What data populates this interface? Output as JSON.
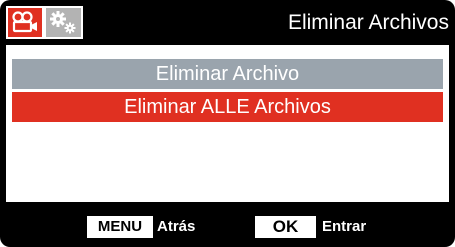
{
  "header": {
    "title": "Eliminar Archivos",
    "tabs": [
      {
        "icon": "video-camera-icon",
        "active": true
      },
      {
        "icon": "gears-icon",
        "active": false
      }
    ]
  },
  "menu": {
    "items": [
      {
        "label": "Eliminar Archivo",
        "selected": false
      },
      {
        "label": "Eliminar ALLE Archivos",
        "selected": true
      }
    ]
  },
  "footer": {
    "menu_key": "MENU",
    "menu_action": "Atrás",
    "ok_key": "OK",
    "ok_action": "Entrar"
  },
  "colors": {
    "accent": "#e03021",
    "unselected_item": "#9aa4ad",
    "inactive_tab": "#b3b3b3",
    "background": "#000000"
  }
}
